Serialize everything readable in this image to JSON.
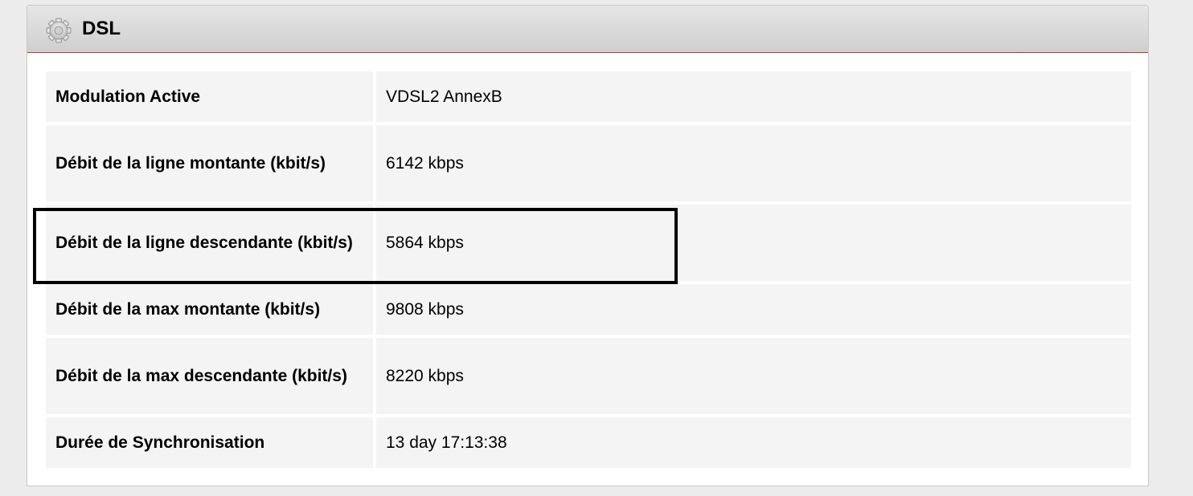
{
  "panel": {
    "title": "DSL",
    "icon": "gear-icon"
  },
  "rows": [
    {
      "label": "Modulation Active",
      "value": "VDSL2 AnnexB"
    },
    {
      "label": "Débit de la ligne montante (kbit/s)",
      "value": "6142 kbps"
    },
    {
      "label": "Débit de la ligne descendante (kbit/s)",
      "value": "5864 kbps"
    },
    {
      "label": "Débit de la max montante (kbit/s)",
      "value": "9808 kbps"
    },
    {
      "label": "Débit de la max descendante (kbit/s)",
      "value": "8220 kbps"
    },
    {
      "label": "Durée de Synchronisation",
      "value": "13 day 17:13:38"
    }
  ],
  "colors": {
    "header_accent_line": "#c0392b",
    "cell_background": "#f4f4f4",
    "highlight_border": "#000000"
  }
}
